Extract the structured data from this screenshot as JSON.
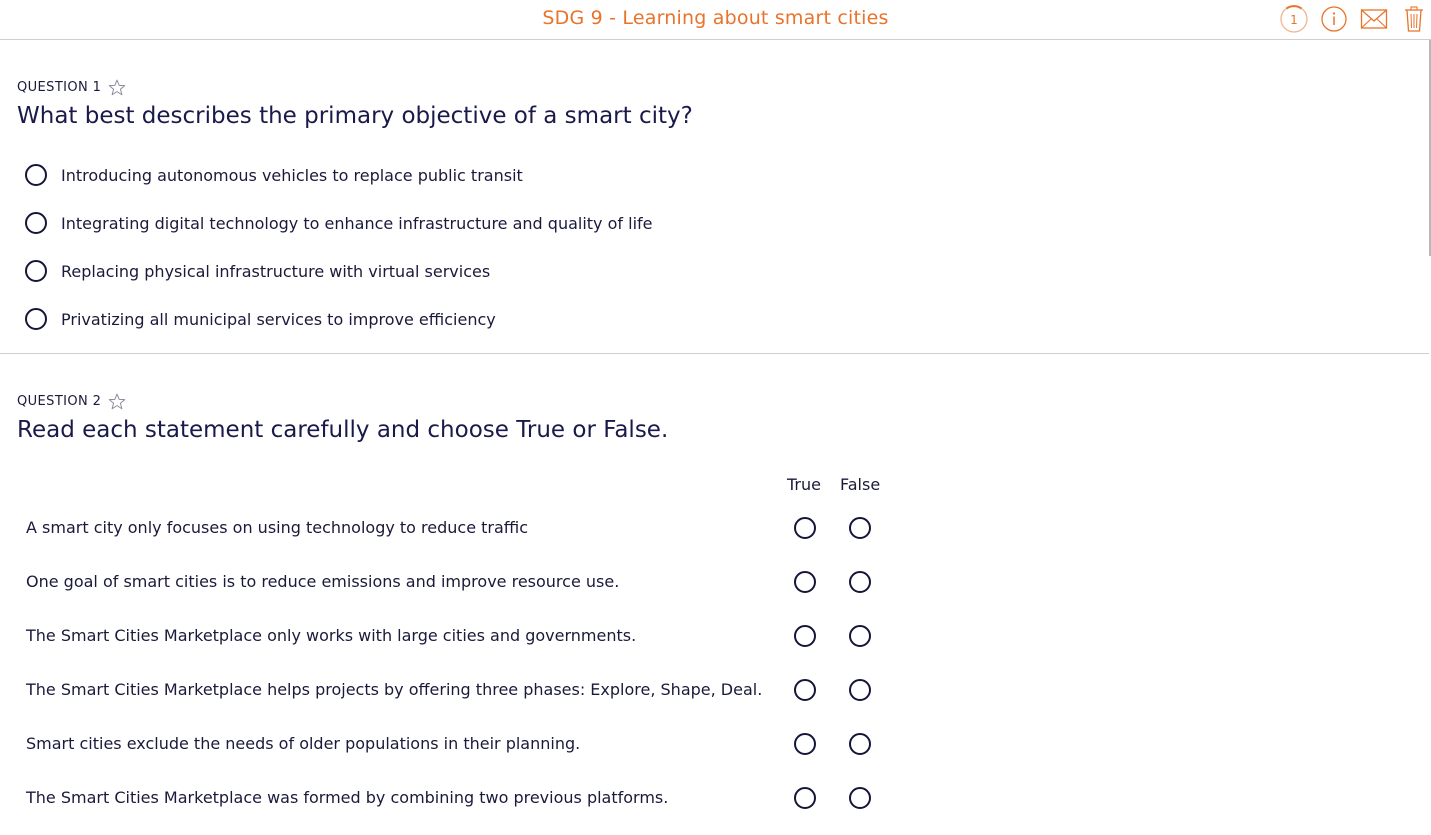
{
  "header": {
    "title": "SDG 9 - Learning about smart cities",
    "counter": "1",
    "icons": [
      "progress-counter-icon",
      "info-icon",
      "mail-icon",
      "trash-icon"
    ],
    "accent_color": "#e8732a"
  },
  "questions": [
    {
      "label": "QUESTION 1",
      "text": "What best describes the primary objective of a smart city?",
      "type": "single-choice",
      "options": [
        "Introducing autonomous vehicles to replace public transit",
        "Integrating digital technology to enhance infrastructure and quality of life",
        "Replacing physical infrastructure with virtual services",
        "Privatizing all municipal services to improve efficiency"
      ]
    },
    {
      "label": "QUESTION 2",
      "text": "Read each statement carefully and choose True or False.",
      "type": "true-false",
      "columns": [
        "True",
        "False"
      ],
      "statements": [
        "A smart city only focuses on using technology to reduce traffic",
        "One goal of smart cities is to reduce emissions and improve resource use.",
        "The Smart Cities Marketplace only works with large cities and governments.",
        "The Smart Cities Marketplace helps projects by offering three phases: Explore, Shape, Deal.",
        "Smart cities exclude the needs of older populations in their planning.",
        "The Smart Cities Marketplace was formed by combining two previous platforms."
      ]
    }
  ]
}
